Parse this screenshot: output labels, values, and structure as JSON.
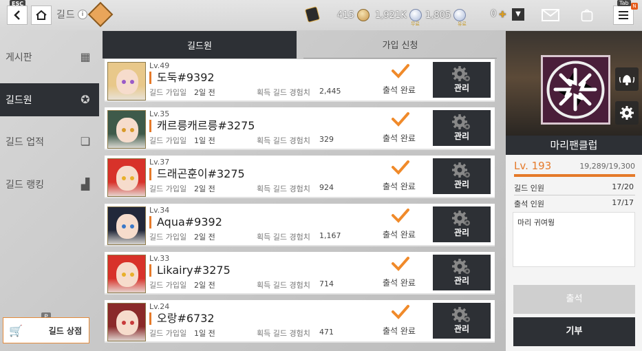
{
  "topbar": {
    "esc_tag": "ESC",
    "title": "길드",
    "info": "i",
    "tab_tag": "Tab",
    "notify": "N",
    "resources": [
      {
        "icon": "ticket-icon",
        "value": ""
      },
      {
        "icon": "gold-coin-icon",
        "value": "415"
      },
      {
        "icon": "gold-coin-icon",
        "value": "1,921K"
      },
      {
        "icon": "crystal-icon",
        "value": "1,805",
        "sub": "무료"
      },
      {
        "icon": "crystal-icon",
        "value": "",
        "sub": "유료"
      },
      {
        "icon": "stamina-icon",
        "value": "0"
      }
    ]
  },
  "sidebar": {
    "items": [
      {
        "label": "게시판",
        "icon": "board-icon"
      },
      {
        "label": "길드원",
        "icon": "members-icon"
      },
      {
        "label": "길드 업적",
        "icon": "achievement-icon"
      },
      {
        "label": "길드 랭킹",
        "icon": "ranking-icon"
      }
    ],
    "shop_label": "길드 상점",
    "shop_badge": "P"
  },
  "tabs": [
    "길드원",
    "가입 신청"
  ],
  "members_labels": {
    "joined": "길드 가입일",
    "exp": "획득 길드 경험치",
    "attendance": "출석 완료",
    "manage": "관리"
  },
  "members": [
    {
      "level": "Lv.49",
      "name": "도둑#9392",
      "joined": "2일 전",
      "exp": "2,445",
      "hair": "#e8c88a",
      "eye": "#9a5ac8"
    },
    {
      "level": "Lv.35",
      "name": "캐르릉캐르릉#3275",
      "joined": "1일 전",
      "exp": "329",
      "hair": "#3e5a4a",
      "eye": "#d89a2a"
    },
    {
      "level": "Lv.37",
      "name": "드래곤훈이#3275",
      "joined": "2일 전",
      "exp": "924",
      "hair": "#d8322a",
      "eye": "#e8b02a"
    },
    {
      "level": "Lv.34",
      "name": "Aqua#9392",
      "joined": "2일 전",
      "exp": "1,167",
      "hair": "#22283a",
      "eye": "#3a78c8"
    },
    {
      "level": "Lv.33",
      "name": "Likairy#3275",
      "joined": "2일 전",
      "exp": "714",
      "hair": "#d8322a",
      "eye": "#e8b02a"
    },
    {
      "level": "Lv.24",
      "name": "오랑#6732",
      "joined": "1일 전",
      "exp": "471",
      "hair": "#8a2a2a",
      "eye": "#c83a3a"
    }
  ],
  "guild": {
    "name": "마리팬클럽",
    "level": "Lv. 193",
    "exp_text": "19,289/19,300",
    "exp_fraction": 0.9994,
    "members_label": "길드 인원",
    "members_value": "17/20",
    "attend_label": "출석 인원",
    "attend_value": "17/17",
    "memo": "마리 귀여웡",
    "attend_button": "출석",
    "donate_button": "기부"
  },
  "colors": {
    "accent": "#e57a2a",
    "dark": "#2d3035"
  }
}
